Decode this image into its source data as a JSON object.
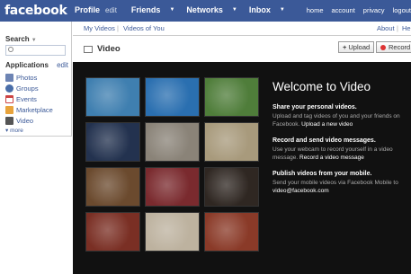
{
  "topbar": {
    "logo": "facebook",
    "nav": [
      {
        "label": "Profile",
        "sub": "edit"
      },
      {
        "label": "Friends",
        "caret": "▼"
      },
      {
        "label": "Networks",
        "caret": "▼"
      },
      {
        "label": "Inbox",
        "caret": "▼"
      }
    ],
    "right": [
      "home",
      "account",
      "privacy",
      "logout"
    ]
  },
  "sidebar": {
    "search_label": "Search",
    "apps_label": "Applications",
    "apps_edit": "edit",
    "items": [
      {
        "label": "Photos",
        "icon": "photos-icon",
        "color": "#6d84b4"
      },
      {
        "label": "Groups",
        "icon": "groups-icon",
        "color": "#4a6ea9"
      },
      {
        "label": "Events",
        "icon": "events-icon",
        "color": "#c44"
      },
      {
        "label": "Marketplace",
        "icon": "marketplace-icon",
        "color": "#e8a33b"
      },
      {
        "label": "Video",
        "icon": "video-icon",
        "color": "#555"
      }
    ],
    "more": "more"
  },
  "subtabs": {
    "my_videos": "My Videos",
    "videos_of_you": "Videos of You",
    "about": "About",
    "help": "Help"
  },
  "header": {
    "title": "Video",
    "upload": "Upload",
    "record": "Record"
  },
  "welcome": {
    "title": "Welcome to Video",
    "sections": [
      {
        "heading": "Share your personal videos.",
        "body": "Upload and tag videos of you and your friends on Facebook.",
        "link": "Upload a new video"
      },
      {
        "heading": "Record and send video messages.",
        "body": "Use your webcam to record yourself in a video message.",
        "link": "Record a video message"
      },
      {
        "heading": "Publish videos from your mobile.",
        "body": "Send your mobile videos via Facebook Mobile to",
        "link": "video@facebook.com"
      }
    ]
  },
  "thumbnails": [
    {
      "name": "thumb-toy-figure",
      "bg": "#3f7fb0"
    },
    {
      "name": "thumb-underwater",
      "bg": "#2a6fb0"
    },
    {
      "name": "thumb-garden",
      "bg": "#4f7d3a"
    },
    {
      "name": "thumb-stage",
      "bg": "#23324f"
    },
    {
      "name": "thumb-window-silhouette",
      "bg": "#8a8378"
    },
    {
      "name": "thumb-eye-closeup",
      "bg": "#a89a7c"
    },
    {
      "name": "thumb-smiling-man",
      "bg": "#6b4a2e"
    },
    {
      "name": "thumb-concert",
      "bg": "#7a2a2e"
    },
    {
      "name": "thumb-man-dark",
      "bg": "#2f2722"
    },
    {
      "name": "thumb-friends-group",
      "bg": "#7a2f24"
    },
    {
      "name": "thumb-skier",
      "bg": "#bdb29f"
    },
    {
      "name": "thumb-sunglasses",
      "bg": "#8a3a28"
    }
  ]
}
